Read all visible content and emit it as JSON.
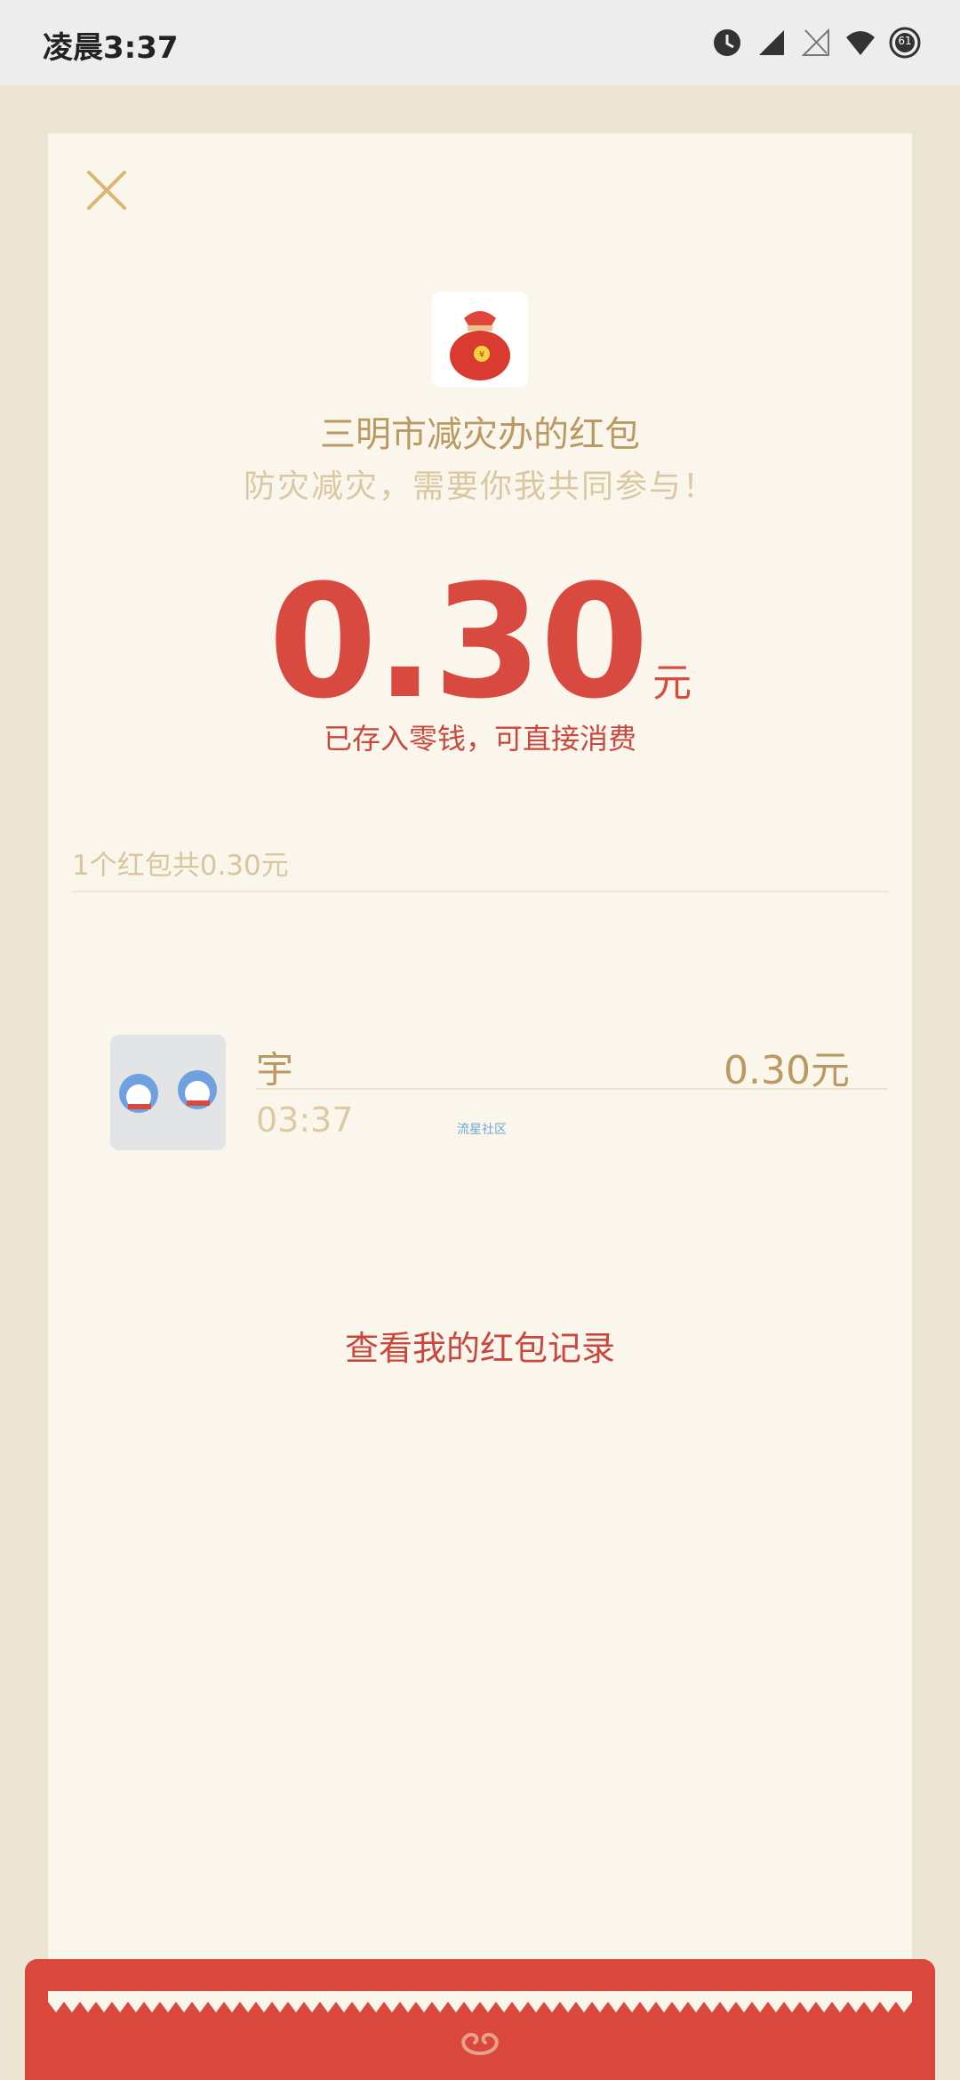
{
  "status_bar": {
    "time": "凌晨3:37",
    "battery": "61"
  },
  "redpacket": {
    "sender_title": "三明市减灾办的红包",
    "subtitle": "防灾减灾，需要你我共同参与！",
    "amount": "0.30",
    "amount_unit": "元",
    "deposit_note": "已存入零钱，可直接消费",
    "summary": "1个红包共0.30元"
  },
  "records": [
    {
      "name": "宇",
      "time": "03:37",
      "amount": "0.30元",
      "watermark": "流星社区"
    }
  ],
  "history_link": "查看我的红包记录",
  "colors": {
    "accent_red": "#d84a3f",
    "gold": "#b99a63",
    "card_bg": "#faf6ec",
    "page_bg": "#ede5d3"
  }
}
